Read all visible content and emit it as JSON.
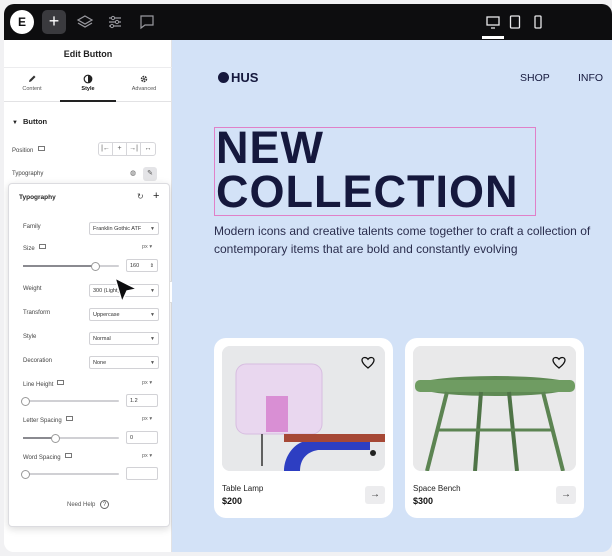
{
  "topbar": {
    "logo": "E",
    "add": "+",
    "icons": [
      "layers-icon",
      "settings-sliders-icon",
      "comments-icon"
    ],
    "devices": [
      "desktop-icon",
      "tablet-icon",
      "mobile-icon"
    ]
  },
  "panel": {
    "title": "Edit Button",
    "tabs": [
      {
        "label": "Content",
        "icon": "pencil-icon"
      },
      {
        "label": "Style",
        "icon": "contrast-icon"
      },
      {
        "label": "Advanced",
        "icon": "gear-icon"
      }
    ],
    "section": "Button",
    "position_label": "Position",
    "typography_label": "Typography",
    "popover": {
      "title": "Typography",
      "family_label": "Family",
      "family_value": "Franklin Gothic ATF",
      "size_label": "Size",
      "size_unit": "px",
      "size_value": "160",
      "weight_label": "Weight",
      "weight_value": "300 (Light)",
      "transform_label": "Transform",
      "transform_value": "Uppercase",
      "style_label": "Style",
      "style_value": "Normal",
      "decoration_label": "Decoration",
      "decoration_value": "None",
      "line_height_label": "Line Height",
      "line_height_unit": "px",
      "line_height_value": "1.2",
      "letter_spacing_label": "Letter Spacing",
      "letter_spacing_unit": "px",
      "letter_spacing_value": "0",
      "word_spacing_label": "Word Spacing",
      "word_spacing_unit": "px",
      "word_spacing_value": ""
    },
    "help": "Need Help"
  },
  "site": {
    "brand": "HUS",
    "nav": [
      "SHOP",
      "INFO"
    ],
    "headline_1": "NEW",
    "headline_2": "COLLECTION",
    "subtitle": "Modern icons and creative talents come together to craft a collection of contemporary items that are bold and constantly evolving",
    "products": [
      {
        "name": "Table Lamp",
        "price": "$200"
      },
      {
        "name": "Space Bench",
        "price": "$300"
      }
    ]
  },
  "colors": {
    "canvas_bg": "#d3e2f7",
    "headline": "#15183d",
    "selection": "#e080c8"
  }
}
